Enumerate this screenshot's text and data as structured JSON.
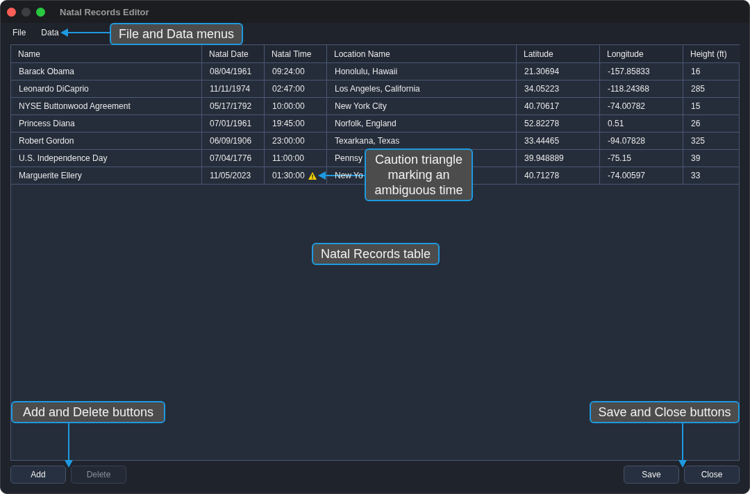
{
  "window": {
    "title": "Natal Records Editor"
  },
  "menu": [
    "File",
    "Data"
  ],
  "table": {
    "columns": [
      "Name",
      "Natal Date",
      "Natal Time",
      "Location Name",
      "Latitude",
      "Longitude",
      "Height (ft)"
    ],
    "rows": [
      {
        "cells": [
          "Barack Obama",
          "08/04/1961",
          "09:24:00",
          "Honolulu, Hawaii",
          "21.30694",
          "-157.85833",
          "16"
        ],
        "warning": false
      },
      {
        "cells": [
          "Leonardo DiCaprio",
          "11/11/1974",
          "02:47:00",
          "Los Angeles, California",
          "34.05223",
          "-118.24368",
          "285"
        ],
        "warning": false
      },
      {
        "cells": [
          "NYSE Buttonwood Agreement",
          "05/17/1792",
          "10:00:00",
          "New York City",
          "40.70617",
          "-74.00782",
          "15"
        ],
        "warning": false
      },
      {
        "cells": [
          "Princess Diana",
          "07/01/1961",
          "19:45:00",
          "Norfolk, England",
          "52.82278",
          "0.51",
          "26"
        ],
        "warning": false
      },
      {
        "cells": [
          "Robert Gordon",
          "06/09/1906",
          "23:00:00",
          "Texarkana, Texas",
          "33.44465",
          "-94.07828",
          "325"
        ],
        "warning": false
      },
      {
        "cells": [
          "U.S. Independence Day",
          "07/04/1776",
          "11:00:00",
          "Pennsy",
          "39.948889",
          "-75.15",
          "39"
        ],
        "warning": false
      },
      {
        "cells": [
          "Marguerite Ellery",
          "11/05/2023",
          "01:30:00",
          "New Yo",
          "40.71278",
          "-74.00597",
          "33"
        ],
        "warning": true
      }
    ]
  },
  "buttons_left": [
    {
      "label": "Add",
      "disabled": false
    },
    {
      "label": "Delete",
      "disabled": true
    }
  ],
  "buttons_right": [
    {
      "label": "Save",
      "disabled": false
    },
    {
      "label": "Close",
      "disabled": false
    }
  ],
  "annotations": [
    {
      "text": "File and Data menus",
      "kind": "leftward"
    },
    {
      "text": "Caution triangle marking an ambiguous time",
      "kind": "leftward"
    },
    {
      "text": "Natal Records table",
      "kind": "plain"
    },
    {
      "text": "Add and Delete buttons",
      "kind": "downward"
    },
    {
      "text": "Save and Close buttons",
      "kind": "downward"
    }
  ]
}
